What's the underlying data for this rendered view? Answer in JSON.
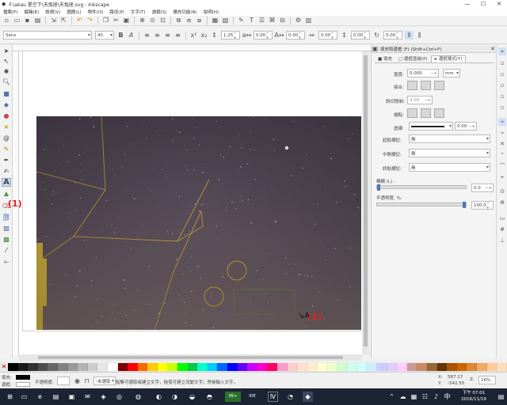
{
  "window": {
    "title": "F:\\akau 星空下\\天兔座\\天兔座.svg - Inkscape",
    "controls": [
      "—",
      "☐",
      "✕"
    ]
  },
  "menu": [
    "檔案(F)",
    "編輯(E)",
    "檢視(V)",
    "圖層(L)",
    "物件(O)",
    "路徑(P)",
    "文字(T)",
    "濾鏡(S)",
    "擴充功能(N)",
    "說明(H)"
  ],
  "text_toolbar": {
    "font_family": "Sans",
    "font_size": "40",
    "line_spacing": "1.25",
    "letter_spacing": "0.00",
    "word_spacing": "0.00",
    "h_kern": "0.00",
    "v_kern": "0.00",
    "rotation": "0.00"
  },
  "fill_stroke_dialog": {
    "title": "填充和邊框 (F) (Shift+Ctrl+F)",
    "tabs": [
      "填充",
      "邊框塗繪(P)",
      "邊框樣式(Y)"
    ],
    "active_tab": 2,
    "width_label": "寬度:",
    "width_value": "0.000",
    "width_unit": "mm",
    "join_label": "接合:",
    "miter_label": "斜切限制:",
    "miter_value": "4.00",
    "cap_label": "端點:",
    "dashes_label": "虛線:",
    "dash_offset": "0.00",
    "start_marker_label": "起點標記:",
    "start_marker_value": "無",
    "mid_marker_label": "中間標記:",
    "mid_marker_value": "無",
    "end_marker_label": "終點標記:",
    "end_marker_value": "無",
    "blur_label": "模糊 (L) :",
    "blur_value": "0.0",
    "opacity_label": "不透明度, %:",
    "opacity_value": "100.0",
    "blur_fraction": 0,
    "opacity_fraction": 1
  },
  "status": {
    "fill_label": "填充:",
    "stroke_label": "邊框:",
    "opacity_label": "不透明度:",
    "layer": "-未選取",
    "message": "點擊可選取或建立文字，拖曳可建立流動文字；然後輸入文字。",
    "x_label": "X:",
    "x_value": "567.17",
    "y_label": "Y:",
    "y_value": "-542.55",
    "z_label": "Z:",
    "zoom": "16%"
  },
  "clock": {
    "time": "下午 07:01",
    "date": "2016/11/19"
  },
  "annotations": [
    "(1)",
    "(2)"
  ],
  "palette_colors": [
    "#000000",
    "#1a1a1a",
    "#333333",
    "#4d4d4d",
    "#666666",
    "#808080",
    "#999999",
    "#b3b3b3",
    "#cccccc",
    "#e6e6e6",
    "#ffffff",
    "#800000",
    "#ff0000",
    "#ff6600",
    "#ffcc00",
    "#ffff00",
    "#ccff00",
    "#00ff00",
    "#00cc44",
    "#00ffcc",
    "#00ccff",
    "#0066ff",
    "#0000ff",
    "#6600ff",
    "#cc00ff",
    "#ff00cc",
    "#ff0066",
    "#ff99cc",
    "#ffcccc",
    "#ffe0cc",
    "#ffeecc",
    "#ffffcc",
    "#eeffcc",
    "#ccffcc",
    "#ccffee",
    "#ccffff",
    "#cceeff",
    "#ccccff",
    "#e0ccff",
    "#ffccff",
    "#cc9999",
    "#cc8866",
    "#996633",
    "#663300",
    "#aa5500",
    "#cc6600",
    "#dd8833",
    "#eeaa66",
    "#ffcc99",
    "#ffddbb"
  ],
  "taskbar_labels": [
    "e",
    "99+",
    "IDE"
  ]
}
